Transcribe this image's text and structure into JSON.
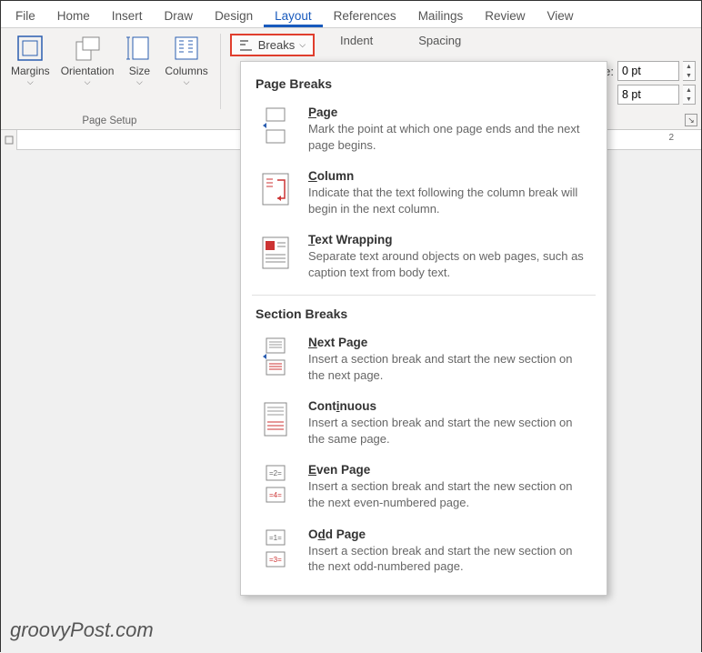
{
  "tabs": [
    "File",
    "Home",
    "Insert",
    "Draw",
    "Design",
    "Layout",
    "References",
    "Mailings",
    "Review",
    "View"
  ],
  "active_tab": "Layout",
  "ribbon": {
    "margins": "Margins",
    "orientation": "Orientation",
    "size": "Size",
    "columns": "Columns",
    "breaks": "Breaks",
    "page_setup_label": "Page Setup",
    "indent_label": "Indent",
    "spacing_label": "Spacing",
    "spacing_before_prefix": "e:",
    "spacing_before": "0 pt",
    "spacing_after": "8 pt"
  },
  "ruler": {
    "num2": "2"
  },
  "dropdown": {
    "section1_title": "Page Breaks",
    "section2_title": "Section Breaks",
    "items": [
      {
        "title_accel": "P",
        "title_rest": "age",
        "desc": "Mark the point at which one page ends and the next page begins."
      },
      {
        "title_accel": "C",
        "title_rest": "olumn",
        "desc": "Indicate that the text following the column break will begin in the next column."
      },
      {
        "title_accel": "T",
        "title_rest": "ext Wrapping",
        "desc": "Separate text around objects on web pages, such as caption text from body text."
      },
      {
        "title_accel": "N",
        "title_rest": "ext Page",
        "desc": "Insert a section break and start the new section on the next page."
      },
      {
        "title_accel": "",
        "title_rest": "Continuous",
        "title_u_idx": 4,
        "desc": "Insert a section break and start the new section on the same page."
      },
      {
        "title_accel": "E",
        "title_rest": "ven Page",
        "desc": "Insert a section break and start the new section on the next even-numbered page."
      },
      {
        "title_accel": "",
        "title_rest": "Odd Page",
        "title_u_idx": 1,
        "desc": "Insert a section break and start the new section on the next odd-numbered page."
      }
    ]
  },
  "watermark": "groovyPost.com"
}
